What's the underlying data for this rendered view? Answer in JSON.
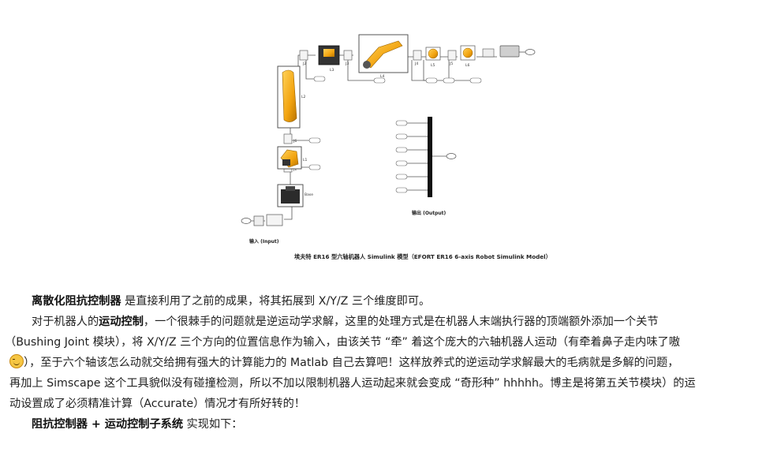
{
  "figure": {
    "caption": "埃夫特 ER16 型六轴机器人 Simulink 模型（EFORT ER16 6-axis Robot Simulink Model）",
    "input_label": "输入 (Input)",
    "output_label": "输出 (Output)",
    "link_labels": [
      "L2",
      "L3",
      "L4",
      "L5",
      "L6",
      "L1",
      "Base"
    ],
    "joint_labels": [
      "J2",
      "J3",
      "J4",
      "J5",
      "J6",
      "J1"
    ],
    "colors": {
      "link": "#f2a30f",
      "link_dark": "#b87400",
      "base": "#2b2b2b",
      "mux": "#111111",
      "line": "#555555"
    }
  },
  "paragraphs": {
    "p1": {
      "bold": "离散化阻抗控制器",
      "text": " 是直接利用了之前的成果，将其拓展到 X/Y/Z 三个维度即可。"
    },
    "p2": {
      "t1": "对于机器人的",
      "bold": "运动控制",
      "t2": "，一个很棘手的问题就是逆运动学求解，这里的处理方式是在机器人末端执行器的顶端额外添加一个关节",
      "t3": "（Bushing Joint 模块），将 X/Y/Z 三个方向的位置信息作为输入，由该关节 “牵” 着这个庞大的六轴机器人运动（有牵着鼻子走内味了嗷",
      "t4": "），至于六个轴该怎么动就交给拥有强大的计算能力的 Matlab 自己去算吧！这样放养式的逆运动学求解最大的毛病就是多解的问题，",
      "t5": "再加上 Simscape 这个工具貌似没有碰撞检测，所以不加以限制机器人运动起来就会变成 “奇形种” hhhhh。博主是将第五关节模块）的运",
      "t6": "动设置成了必须精准计算（Accurate）情况才有所好转的！"
    },
    "p3": {
      "bold": "阻抗控制器 + 运动控制子系统",
      "text": " 实现如下："
    }
  }
}
